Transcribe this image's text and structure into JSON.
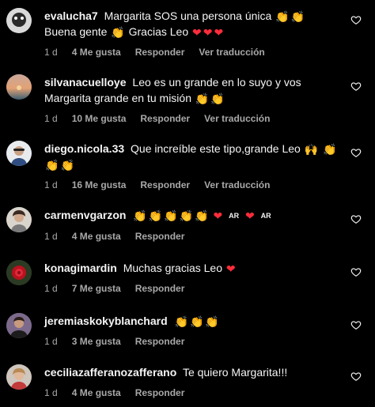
{
  "comments": [
    {
      "user": "evalucha7",
      "text": "Margarita SOS una persona única",
      "text2": "Buena gente",
      "text3": "Gracias Leo",
      "time": "1 d",
      "likes": "4 Me gusta",
      "reply": "Responder",
      "translate": "Ver traducción"
    },
    {
      "user": "silvanacuelloye",
      "text": "Leo es un grande en lo suyo y vos Margarita grande en tu misión",
      "time": "1 d",
      "likes": "10 Me gusta",
      "reply": "Responder",
      "translate": "Ver traducción"
    },
    {
      "user": "diego.nicola.33",
      "text": "Que increíble este tipo,grande Leo",
      "time": "1 d",
      "likes": "16 Me gusta",
      "reply": "Responder",
      "translate": "Ver traducción"
    },
    {
      "user": "carmenvgarzon",
      "flag_label": "AR",
      "time": "1 d",
      "likes": "4 Me gusta",
      "reply": "Responder"
    },
    {
      "user": "konagimardin",
      "text": "Muchas gracias Leo",
      "time": "1 d",
      "likes": "7 Me gusta",
      "reply": "Responder"
    },
    {
      "user": "jeremiaskokyblanchard",
      "time": "1 d",
      "likes": "3 Me gusta",
      "reply": "Responder"
    },
    {
      "user": "ceciliazafferanozafferano",
      "text": "Te quiero Margarita!!!",
      "time": "1 d",
      "likes": "4 Me gusta",
      "reply": "Responder"
    }
  ],
  "icons": {
    "like": "heart-outline-icon",
    "clap": "clapping-hands-emoji",
    "red_heart": "red-heart-emoji",
    "raised_hands": "raising-hands-emoji"
  },
  "colors": {
    "background": "#000000",
    "text": "#f5f5f5",
    "meta": "#a8a8a8",
    "red_heart": "#ff2c3b"
  }
}
